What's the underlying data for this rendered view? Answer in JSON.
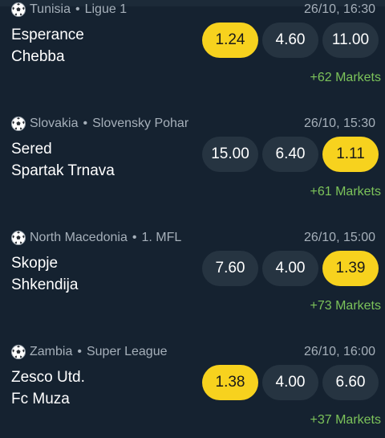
{
  "matches": [
    {
      "sport_icon": "soccer-ball-icon",
      "country": "Tunisia",
      "league": "Ligue 1",
      "datetime": "26/10, 16:30",
      "home": "Esperance",
      "away": "Chebba",
      "odds": [
        "1.24",
        "4.60",
        "11.00"
      ],
      "highlight": 0,
      "markets": "+62 Markets"
    },
    {
      "sport_icon": "soccer-ball-icon",
      "country": "Slovakia",
      "league": "Slovensky Pohar",
      "datetime": "26/10, 15:30",
      "home": "Sered",
      "away": "Spartak Trnava",
      "odds": [
        "15.00",
        "6.40",
        "1.11"
      ],
      "highlight": 2,
      "markets": "+61 Markets"
    },
    {
      "sport_icon": "soccer-ball-icon",
      "country": "North Macedonia",
      "league": "1. MFL",
      "datetime": "26/10, 15:00",
      "home": "Skopje",
      "away": "Shkendija",
      "odds": [
        "7.60",
        "4.00",
        "1.39"
      ],
      "highlight": 2,
      "markets": "+73 Markets"
    },
    {
      "sport_icon": "soccer-ball-icon",
      "country": "Zambia",
      "league": "Super League",
      "datetime": "26/10, 16:00",
      "home": "Zesco Utd.",
      "away": "Fc Muza",
      "odds": [
        "1.38",
        "4.00",
        "6.60"
      ],
      "highlight": 0,
      "markets": "+37 Markets"
    }
  ],
  "colors": {
    "background": "#152230",
    "odd_button": "#263441",
    "odd_highlight": "#f7d21e",
    "markets_link": "#7cc35a",
    "meta_text": "#a6b0ba"
  }
}
